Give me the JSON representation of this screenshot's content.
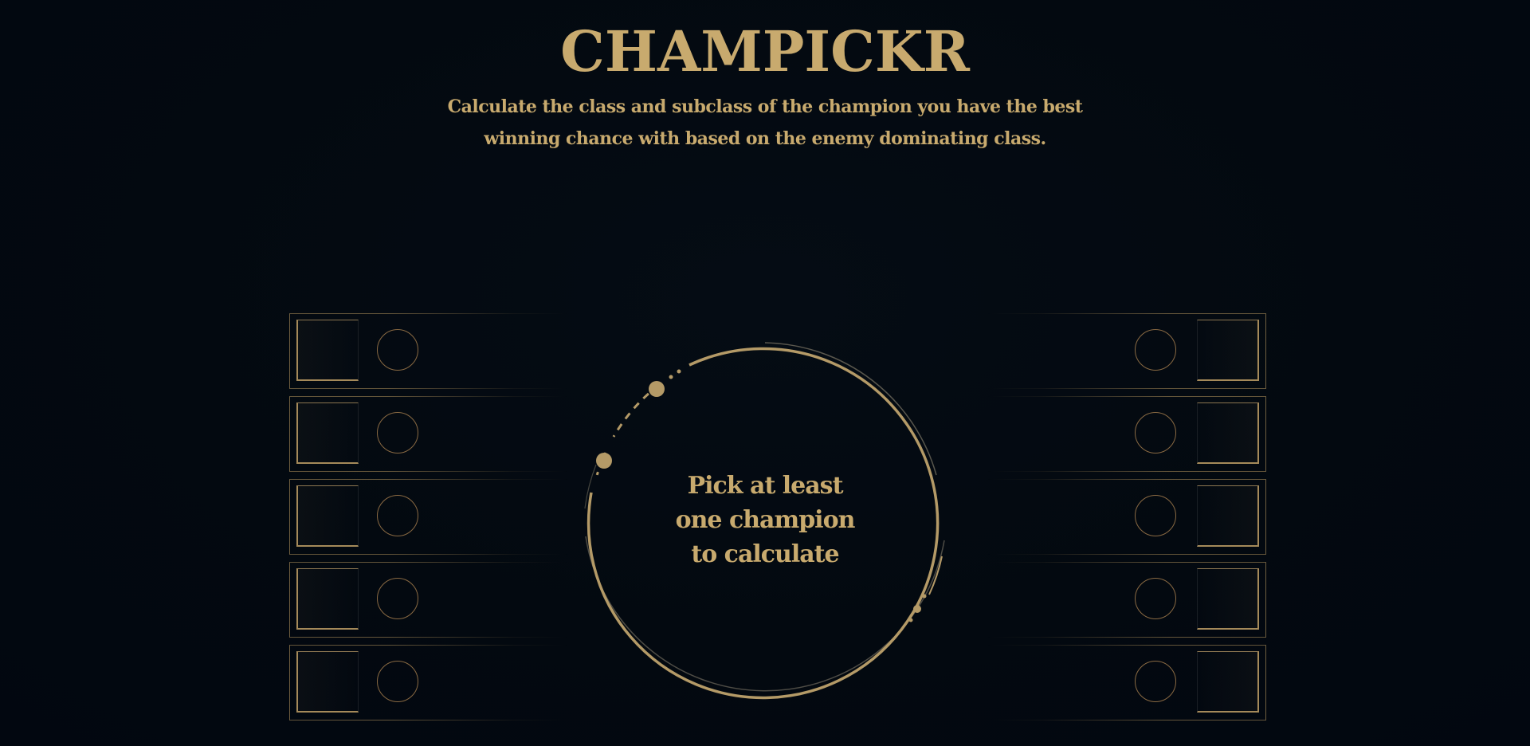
{
  "app": {
    "title": "CHAMPICKR",
    "subtitle": "Calculate the class and subclass of the champion you have the best winning chance with based on the enemy dominating class."
  },
  "calculator": {
    "line1": "Pick at least",
    "line2": "one champion",
    "line3": "to calculate"
  },
  "slots": {
    "left_count": 5,
    "right_count": 5
  },
  "colors": {
    "accent_gold": "#c8aa6e",
    "role_ring": "#8a6a43",
    "background": "#030910"
  }
}
